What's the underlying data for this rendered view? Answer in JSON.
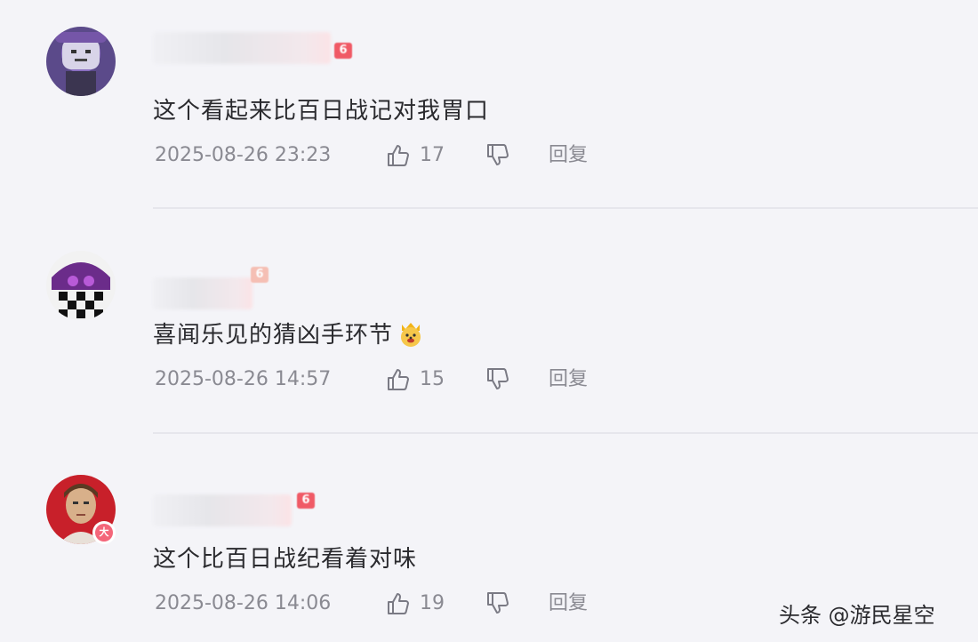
{
  "comments": [
    {
      "level_badge": "6",
      "text": "这个看起来比百日战记对我胃口",
      "time": "2025-08-26 23:23",
      "likes": "17",
      "reply_label": "回复"
    },
    {
      "level_badge": "6",
      "text": "喜闻乐见的猜凶手环节",
      "emoji": "dog-crown-emoji",
      "time": "2025-08-26 14:57",
      "likes": "15",
      "reply_label": "回复"
    },
    {
      "level_badge": "6",
      "vip_badge": "大",
      "text": "这个比百日战纪看着对味",
      "time": "2025-08-26 14:06",
      "likes": "19",
      "reply_label": "回复"
    }
  ],
  "watermark": "头条 @游民星空",
  "icons": {
    "like": "thumbs-up-icon",
    "dislike": "thumbs-down-icon"
  },
  "colors": {
    "text": "#2a2a2e",
    "meta": "#8a8a92",
    "level_badge": "#f05a66",
    "vip_badge": "#f4667a"
  }
}
